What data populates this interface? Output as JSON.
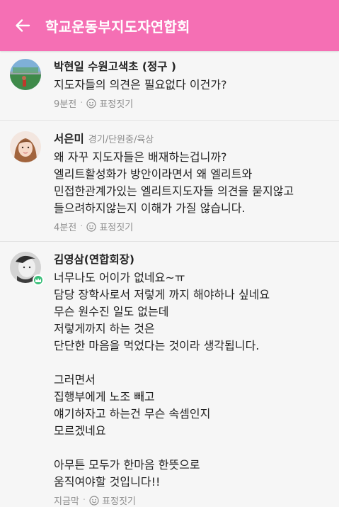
{
  "header": {
    "title": "학교운동부지도자연합회",
    "bg_color": "#f56fb4"
  },
  "comments": [
    {
      "author": "박현일 수원고색초 (정구 )",
      "meta": "",
      "text": "지도자들의 의견은 필요없다 이건가?",
      "time": "9분전",
      "react_label": "표정짓기"
    },
    {
      "author": "서은미",
      "meta": "경기/단원중/육상",
      "text": "왜 자꾸 지도자들은 배재하는겁니까?\n엘리트활성화가 방안이라면서 왜 엘리트와\n민접한관계가있는 엘리트지도자들 의견을 묻지않고\n들으려하지않는지 이해가 가질 않습니다.",
      "time": "4분전",
      "react_label": "표정짓기"
    },
    {
      "author": "김영삼(연합회장)",
      "meta": "",
      "text": "너무나도 어이가 없네요~ㅠ\n담당 장학사로서 저렇게 까지 해야하나 싶네요\n무슨  원수진 일도 없는데\n저렇게까지 하는 것은\n단단한 마음을 먹었다는 것이라 생각됩니다.\n\n그러면서\n집행부에게 노조 빼고\n얘기하자고 하는건 무슨 속셈인지\n모르겠네요\n\n아무튼 모두가 한마음 한뜻으로\n움직여야할 것입니다!!",
      "time": "지금막",
      "react_label": "표정짓기"
    }
  ]
}
